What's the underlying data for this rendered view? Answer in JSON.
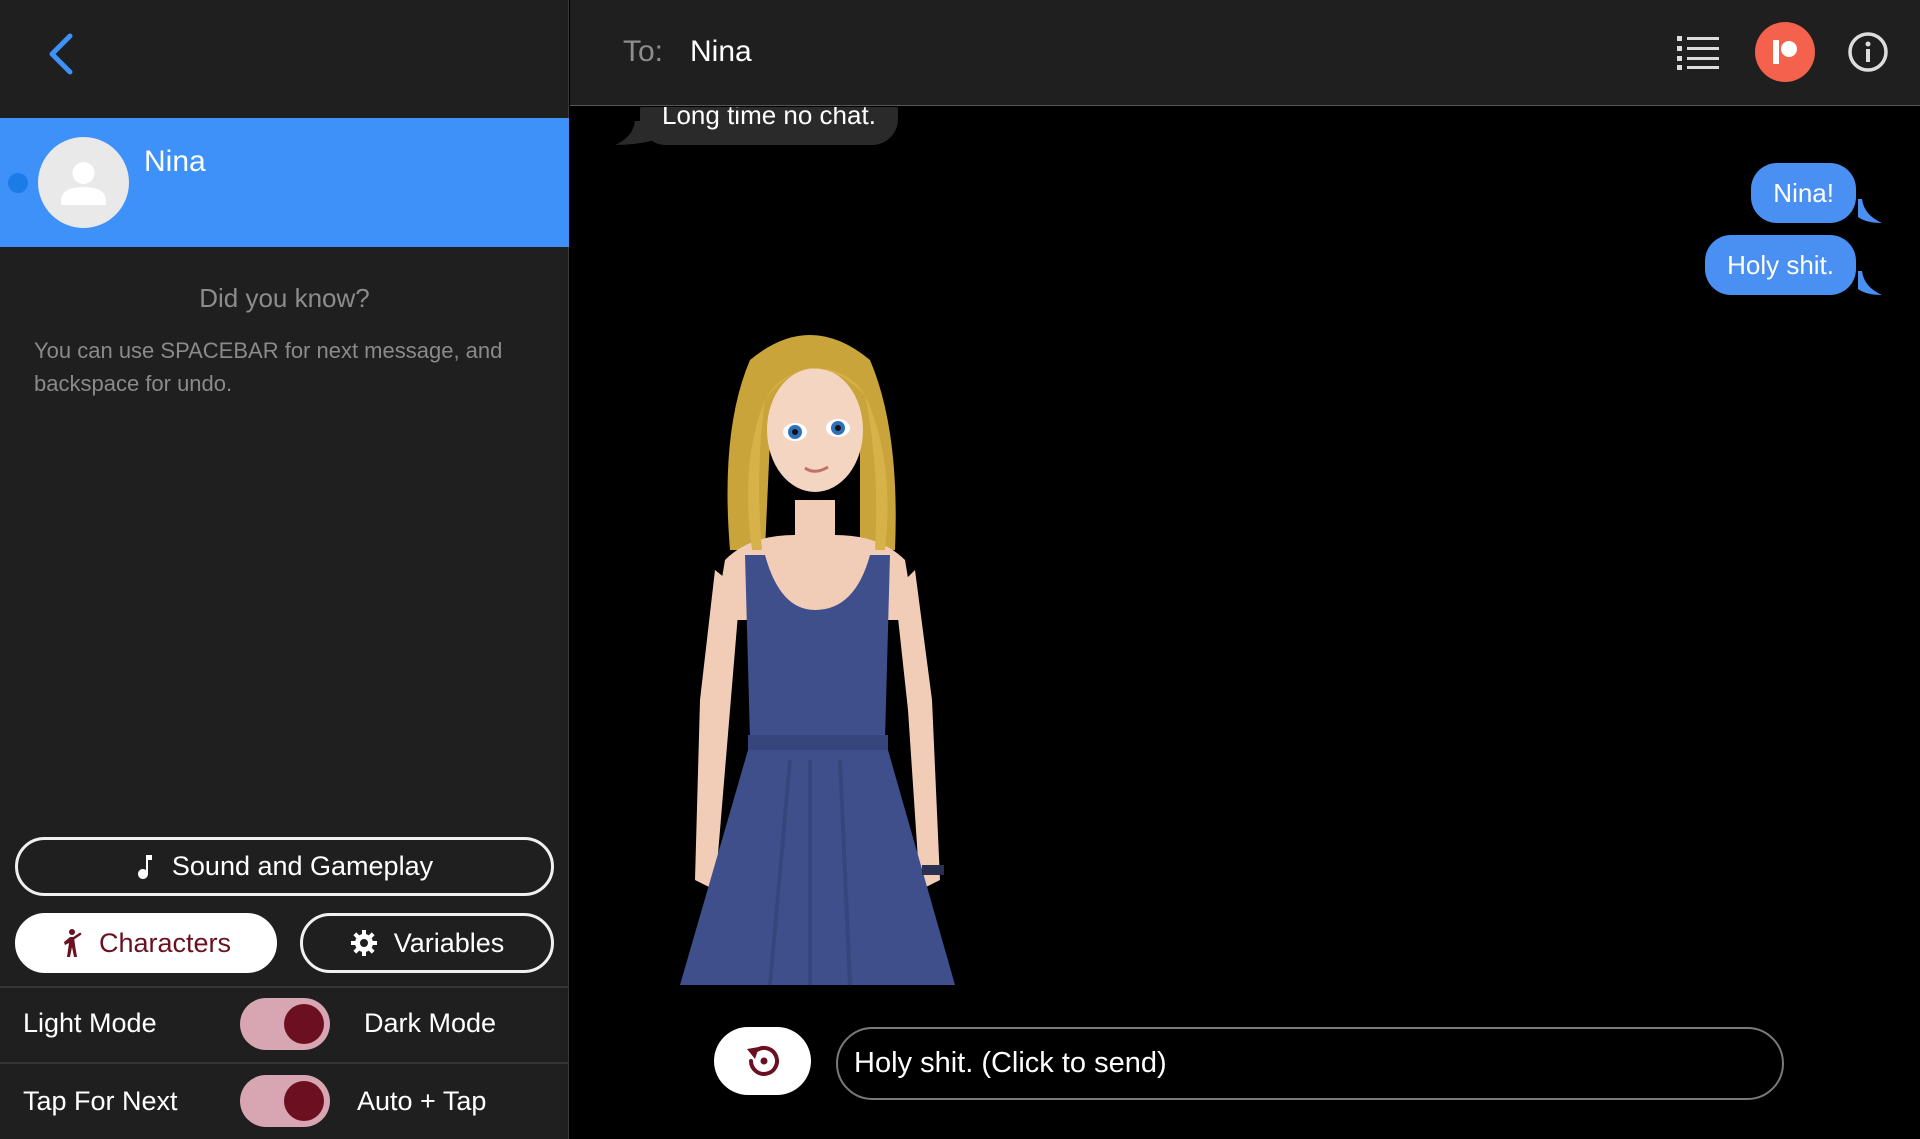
{
  "sidebar": {
    "back_icon": "chevron-left-icon",
    "contact": {
      "name": "Nina",
      "avatar_icon": "user-icon",
      "unread": true
    },
    "tip": {
      "title": "Did you know?",
      "body": "You can use SPACEBAR for next message, and backspace for undo."
    },
    "buttons": {
      "sound": {
        "label": "Sound and Gameplay",
        "icon": "music-note-icon"
      },
      "characters": {
        "label": "Characters",
        "icon": "person-walking-icon",
        "active": true
      },
      "variables": {
        "label": "Variables",
        "icon": "gear-icon"
      }
    },
    "toggles": {
      "theme": {
        "left": "Light Mode",
        "right": "Dark Mode",
        "on": true
      },
      "advance": {
        "left": "Tap For Next",
        "right": "Auto + Tap",
        "on": true
      }
    }
  },
  "header": {
    "to_label": "To:",
    "to_name": "Nina",
    "icons": [
      "list-icon",
      "patreon-icon",
      "info-icon"
    ]
  },
  "chat": {
    "incoming": [
      {
        "text": "Long time no chat."
      }
    ],
    "outgoing": [
      {
        "text": "Nina!"
      },
      {
        "text": "Holy shit."
      }
    ]
  },
  "composer": {
    "undo_icon": "undo-history-icon",
    "next_message": "Holy shit. (Click to send)"
  },
  "colors": {
    "accent": "#3d91f8",
    "bubble_out": "#4a8ff2",
    "switch_track": "#d8a5b2",
    "switch_knob": "#6b0f21",
    "patreon": "#f4614c"
  }
}
